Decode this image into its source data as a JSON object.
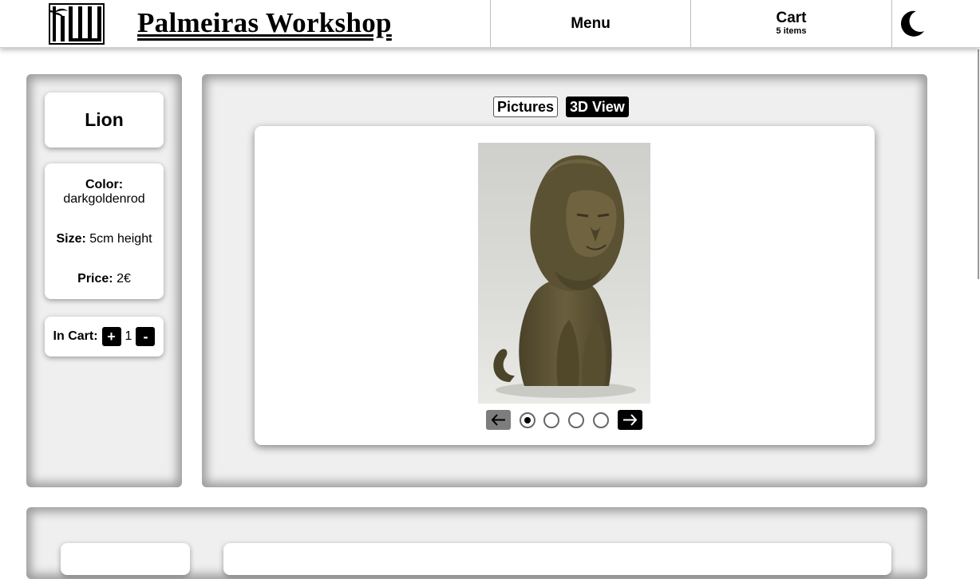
{
  "header": {
    "site_title": "Palmeiras Workshop",
    "menu_label": "Menu",
    "cart_label": "Cart",
    "cart_count": "5 items",
    "theme_icon": "moon-icon"
  },
  "product": {
    "name": "Lion",
    "color_label": "Color:",
    "color_value": "darkgoldenrod",
    "size_label": "Size:",
    "size_value": "5cm height",
    "price_label": "Price:",
    "price_value": "2€",
    "in_cart_label": "In Cart:",
    "plus_label": "+",
    "quantity": "1",
    "minus_label": "-"
  },
  "viewer": {
    "tabs": [
      "Pictures",
      "3D View"
    ],
    "active_tab": "3D View",
    "image_subject": "dark golden 3D-printed lion figurine",
    "image_count": 4,
    "active_image": 1,
    "prev_icon": "arrow-left-icon",
    "next_icon": "arrow-right-icon"
  },
  "colors": {
    "accent": "#000000",
    "panel_bg": "#efefef",
    "figure": "#5c5233"
  }
}
